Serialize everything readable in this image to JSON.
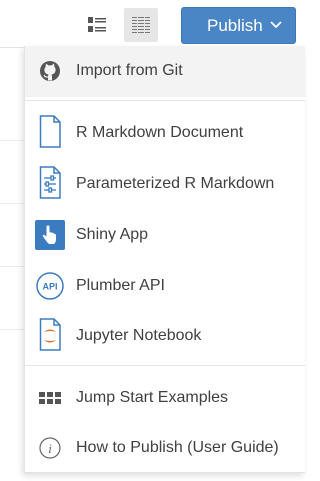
{
  "toolbar": {
    "publish_label": "Publish"
  },
  "menu": {
    "items": [
      {
        "label": "Import from Git",
        "icon": "github-icon"
      },
      {
        "label": "R Markdown Document",
        "icon": "document-icon"
      },
      {
        "label": "Parameterized R Markdown",
        "icon": "sliders-document-icon"
      },
      {
        "label": "Shiny App",
        "icon": "hand-pointer-icon"
      },
      {
        "label": "Plumber API",
        "icon": "api-icon"
      },
      {
        "label": "Jupyter Notebook",
        "icon": "jupyter-icon"
      },
      {
        "label": "Jump Start Examples",
        "icon": "grid-icon"
      },
      {
        "label": "How to Publish (User Guide)",
        "icon": "info-icon"
      }
    ]
  },
  "colors": {
    "accent": "#4a86c5",
    "icon_blue": "#3b7cc0",
    "jupyter_orange": "#e46e2e",
    "text": "#404040"
  }
}
